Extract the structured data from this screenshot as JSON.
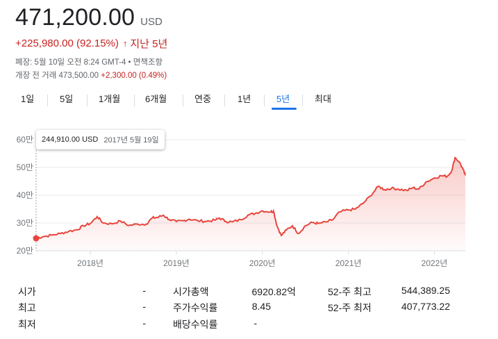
{
  "quote": {
    "price": "471,200.00",
    "currency": "USD",
    "change": "+225,980.00 (92.15%)",
    "change_arrow": "↑",
    "period": "지난 5년",
    "market_close": "폐장: 5월 10일 오전 8:24 GMT-4 • 면책조항",
    "premarket_label": "개장 전 거래 473,500.00",
    "premarket_change": "+2,300.00 (0.49%)"
  },
  "tabs": [
    "1일",
    "5일",
    "1개월",
    "6개월",
    "연중",
    "1년",
    "5년",
    "최대"
  ],
  "active_tab": "5년",
  "tooltip": {
    "value": "244,910.00 USD",
    "date": "2017년 5월 19일"
  },
  "colors": {
    "line": "#e8453c",
    "down": "#c5221f",
    "accent": "#1a73e8"
  },
  "chart_data": {
    "type": "area",
    "y_ticks": [
      "20만",
      "30만",
      "40만",
      "50만",
      "60만"
    ],
    "x_ticks": [
      "2018년",
      "2019년",
      "2020년",
      "2021년",
      "2022년"
    ],
    "y_range": [
      200000,
      600000
    ],
    "x_range": [
      2017.37,
      2022.36
    ],
    "series": [
      {
        "values": [
          [
            2017.37,
            244910
          ],
          [
            2017.45,
            251000
          ],
          [
            2017.55,
            256000
          ],
          [
            2017.65,
            262000
          ],
          [
            2017.75,
            270000
          ],
          [
            2017.85,
            276000
          ],
          [
            2017.92,
            290000
          ],
          [
            2018.0,
            298000
          ],
          [
            2018.08,
            323000
          ],
          [
            2018.15,
            300000
          ],
          [
            2018.25,
            297000
          ],
          [
            2018.35,
            307000
          ],
          [
            2018.45,
            291000
          ],
          [
            2018.55,
            296000
          ],
          [
            2018.65,
            296000
          ],
          [
            2018.72,
            318000
          ],
          [
            2018.78,
            320000
          ],
          [
            2018.85,
            328000
          ],
          [
            2018.92,
            312000
          ],
          [
            2019.0,
            305000
          ],
          [
            2019.08,
            308000
          ],
          [
            2019.15,
            314000
          ],
          [
            2019.25,
            308000
          ],
          [
            2019.35,
            306000
          ],
          [
            2019.45,
            310000
          ],
          [
            2019.5,
            318000
          ],
          [
            2019.58,
            305000
          ],
          [
            2019.65,
            304000
          ],
          [
            2019.75,
            312000
          ],
          [
            2019.83,
            328000
          ],
          [
            2019.92,
            335000
          ],
          [
            2020.0,
            344000
          ],
          [
            2020.1,
            340000
          ],
          [
            2020.13,
            343000
          ],
          [
            2020.17,
            290000
          ],
          [
            2020.22,
            255000
          ],
          [
            2020.28,
            275000
          ],
          [
            2020.35,
            290000
          ],
          [
            2020.42,
            262000
          ],
          [
            2020.5,
            290000
          ],
          [
            2020.58,
            302000
          ],
          [
            2020.65,
            298000
          ],
          [
            2020.75,
            304000
          ],
          [
            2020.82,
            312000
          ],
          [
            2020.9,
            340000
          ],
          [
            2021.0,
            347000
          ],
          [
            2021.08,
            350000
          ],
          [
            2021.17,
            370000
          ],
          [
            2021.25,
            396000
          ],
          [
            2021.35,
            432000
          ],
          [
            2021.42,
            420000
          ],
          [
            2021.5,
            425000
          ],
          [
            2021.58,
            422000
          ],
          [
            2021.68,
            417000
          ],
          [
            2021.75,
            427000
          ],
          [
            2021.82,
            422000
          ],
          [
            2021.9,
            447000
          ],
          [
            2022.0,
            462000
          ],
          [
            2022.08,
            470000
          ],
          [
            2022.15,
            468000
          ],
          [
            2022.2,
            487000
          ],
          [
            2022.24,
            535000
          ],
          [
            2022.29,
            520000
          ],
          [
            2022.33,
            495000
          ],
          [
            2022.36,
            471200
          ]
        ]
      }
    ]
  },
  "stats": {
    "col1": [
      {
        "label": "시가",
        "value": "-"
      },
      {
        "label": "최고",
        "value": "-"
      },
      {
        "label": "최저",
        "value": "-"
      }
    ],
    "col2": [
      {
        "label": "시가총액",
        "value": "6920.82억"
      },
      {
        "label": "주가수익률",
        "value": "8.45"
      },
      {
        "label": "배당수익률",
        "value": "-"
      }
    ],
    "col3": [
      {
        "label": "52-주 최고",
        "value": "544,389.25"
      },
      {
        "label": "52-주 최저",
        "value": "407,773.22"
      }
    ]
  }
}
